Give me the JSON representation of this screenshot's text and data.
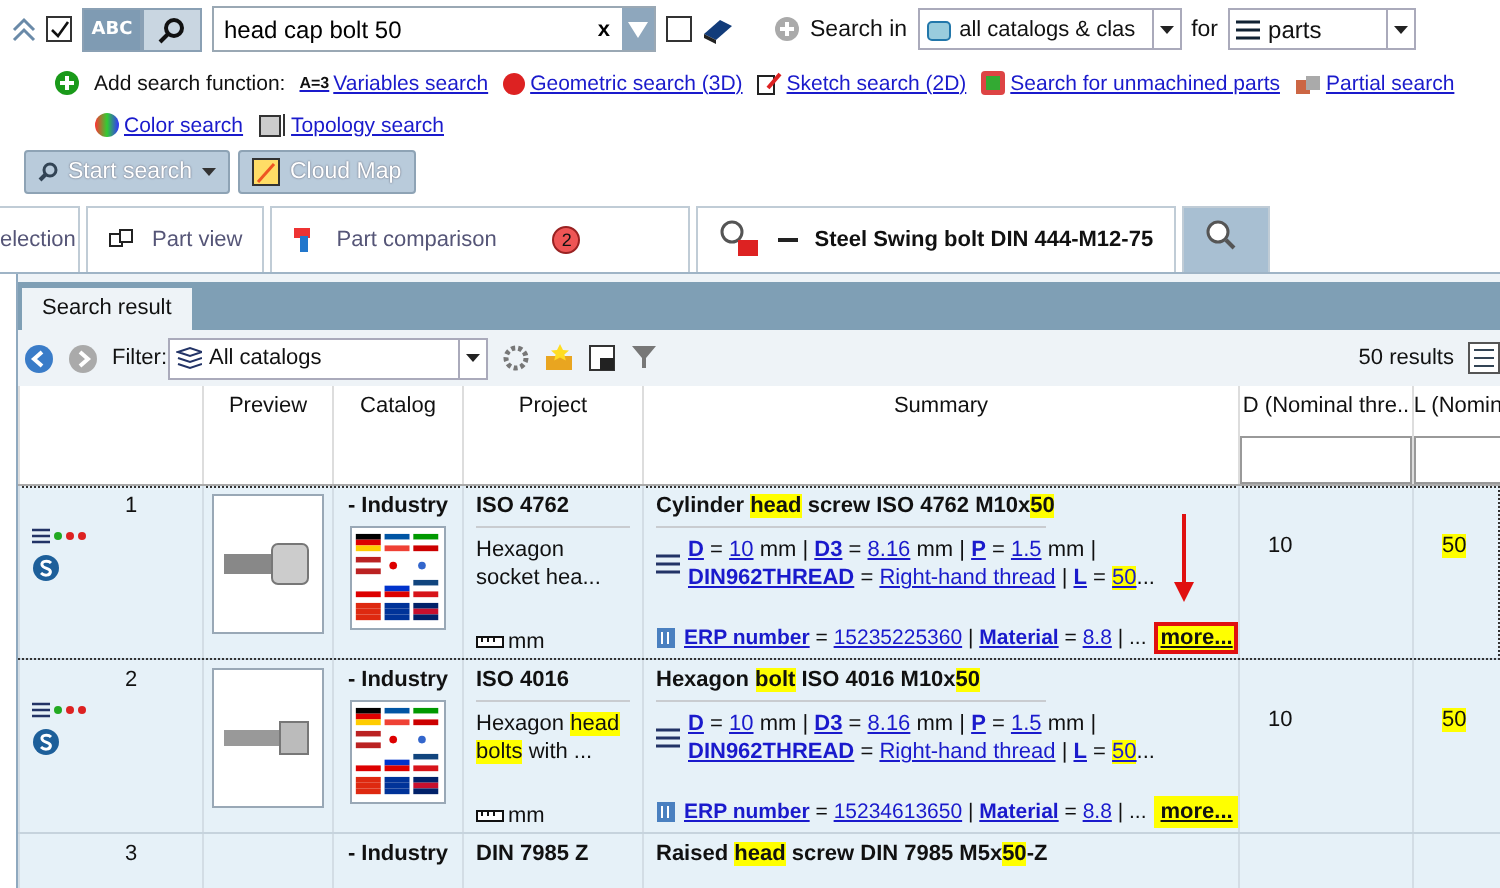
{
  "search_bar": {
    "full_text_checked": true,
    "modes": [
      {
        "kind": "text",
        "label": "ABC",
        "selected": true
      },
      {
        "kind": "image",
        "selected": false
      }
    ],
    "value": "head cap bolt 50",
    "clear": "x",
    "catalog_checked": false,
    "search_in_label": "Search in",
    "search_in_value": "all catalogs & clas",
    "for_label": "for",
    "for_value": "parts"
  },
  "add_functions": {
    "label": "Add search function:",
    "items": [
      {
        "kind": "variables",
        "icon_text": "A=3",
        "label": "Variables search"
      },
      {
        "kind": "geometric",
        "label": "Geometric search (3D)"
      },
      {
        "kind": "sketch",
        "label": "Sketch search (2D)"
      },
      {
        "kind": "unmachined",
        "label": "Search for unmachined parts"
      },
      {
        "kind": "partial",
        "label": "Partial search"
      },
      {
        "kind": "color",
        "label": "Color search"
      },
      {
        "kind": "topology",
        "label": "Topology search"
      }
    ]
  },
  "actions": [
    {
      "kind": "split",
      "label": "Start search"
    },
    {
      "kind": "map",
      "label": "Cloud Map"
    }
  ],
  "tabs": [
    {
      "kind": "plain",
      "label": "election",
      "selected": false
    },
    {
      "kind": "part-view",
      "label": "Part view",
      "selected": false
    },
    {
      "kind": "comparison",
      "label": "Part comparison",
      "badge": "2",
      "selected": false
    },
    {
      "kind": "part",
      "label": "Steel Swing bolt DIN 444-M12-75",
      "selected": false
    },
    {
      "kind": "search",
      "selected": true
    }
  ],
  "result_tab": "Search result",
  "filter": {
    "label": "Filter:",
    "value": "All catalogs"
  },
  "result_count": "50 results",
  "columns": [
    {
      "filter": false
    },
    {
      "label": "Preview",
      "filter": false
    },
    {
      "label": "Catalog",
      "filter": false
    },
    {
      "label": "Project",
      "filter": false
    },
    {
      "label": "Summary",
      "filter": false
    },
    {
      "label": "D (Nominal thre..",
      "filter": true
    },
    {
      "label": "L (Nomin",
      "filter": true
    }
  ],
  "rows": [
    {
      "number": "1",
      "selected": true,
      "catalog": "- Industry",
      "project": "ISO 4762",
      "unit": "mm",
      "kind": "socket-screw",
      "description": [
        {
          "text": "Hexagon",
          "highlight": false
        },
        {
          "text": "socket",
          "highlight": false
        },
        {
          "text": "hea...",
          "highlight": false
        }
      ],
      "title": [
        {
          "text": "Cylinder ",
          "highlight": false
        },
        {
          "text": "head",
          "highlight": true
        },
        {
          "text": " screw ISO 4762 M10x",
          "highlight": false
        },
        {
          "text": "50",
          "highlight": true
        }
      ],
      "equals": "=",
      "divider": "|",
      "specs": [
        {
          "key": "D",
          "value": "10",
          "unit": "mm",
          "highlight": false
        },
        {
          "key": "D3",
          "value": "8.16",
          "unit": "mm",
          "highlight": false
        },
        {
          "key": "P",
          "value": "1.5",
          "unit": "mm",
          "highlight": false
        },
        {
          "key": "DIN962THREAD",
          "value": "Right-hand thread",
          "highlight": false
        },
        {
          "key": "L",
          "value": "50",
          "highlight": true
        }
      ],
      "specs_tail": "...",
      "erp": [
        {
          "key": "ERP number",
          "value": "15235225360"
        },
        {
          "key": "Material",
          "value": "8.8"
        }
      ],
      "erp_tail": "...",
      "more": "more...",
      "more_marked": true,
      "d": "10",
      "l": "50"
    },
    {
      "number": "2",
      "selected": false,
      "catalog": "- Industry",
      "project": "ISO 4016",
      "unit": "mm",
      "kind": "hex-bolt",
      "description": [
        {
          "text": "Hexagon",
          "highlight": false
        },
        {
          "text": "head",
          "highlight": true
        },
        {
          "text": "bolts",
          "highlight": true
        },
        {
          "text": "with ...",
          "highlight": false
        }
      ],
      "title": [
        {
          "text": "Hexagon ",
          "highlight": false
        },
        {
          "text": "bolt",
          "highlight": true
        },
        {
          "text": " ISO 4016 M10x",
          "highlight": false
        },
        {
          "text": "50",
          "highlight": true
        }
      ],
      "equals": "=",
      "divider": "|",
      "specs": [
        {
          "key": "D",
          "value": "10",
          "unit": "mm",
          "highlight": false
        },
        {
          "key": "D3",
          "value": "8.16",
          "unit": "mm",
          "highlight": false
        },
        {
          "key": "P",
          "value": "1.5",
          "unit": "mm",
          "highlight": false
        },
        {
          "key": "DIN962THREAD",
          "value": "Right-hand thread",
          "highlight": false
        },
        {
          "key": "L",
          "value": "50",
          "highlight": true
        }
      ],
      "specs_tail": "...",
      "erp": [
        {
          "key": "ERP number",
          "value": "15234613650"
        },
        {
          "key": "Material",
          "value": "8.8"
        }
      ],
      "erp_tail": "...",
      "more": "more...",
      "more_marked": false,
      "d": "10",
      "l": "50"
    },
    {
      "number": "3",
      "selected": false,
      "catalog": "- Industry",
      "project": "DIN 7985 Z",
      "title": [
        {
          "text": "Raised ",
          "highlight": false
        },
        {
          "text": "head",
          "highlight": true
        },
        {
          "text": " screw DIN 7985 M5x",
          "highlight": false
        },
        {
          "text": "50",
          "highlight": true
        },
        {
          "text": "-Z",
          "highlight": false
        }
      ]
    }
  ]
}
